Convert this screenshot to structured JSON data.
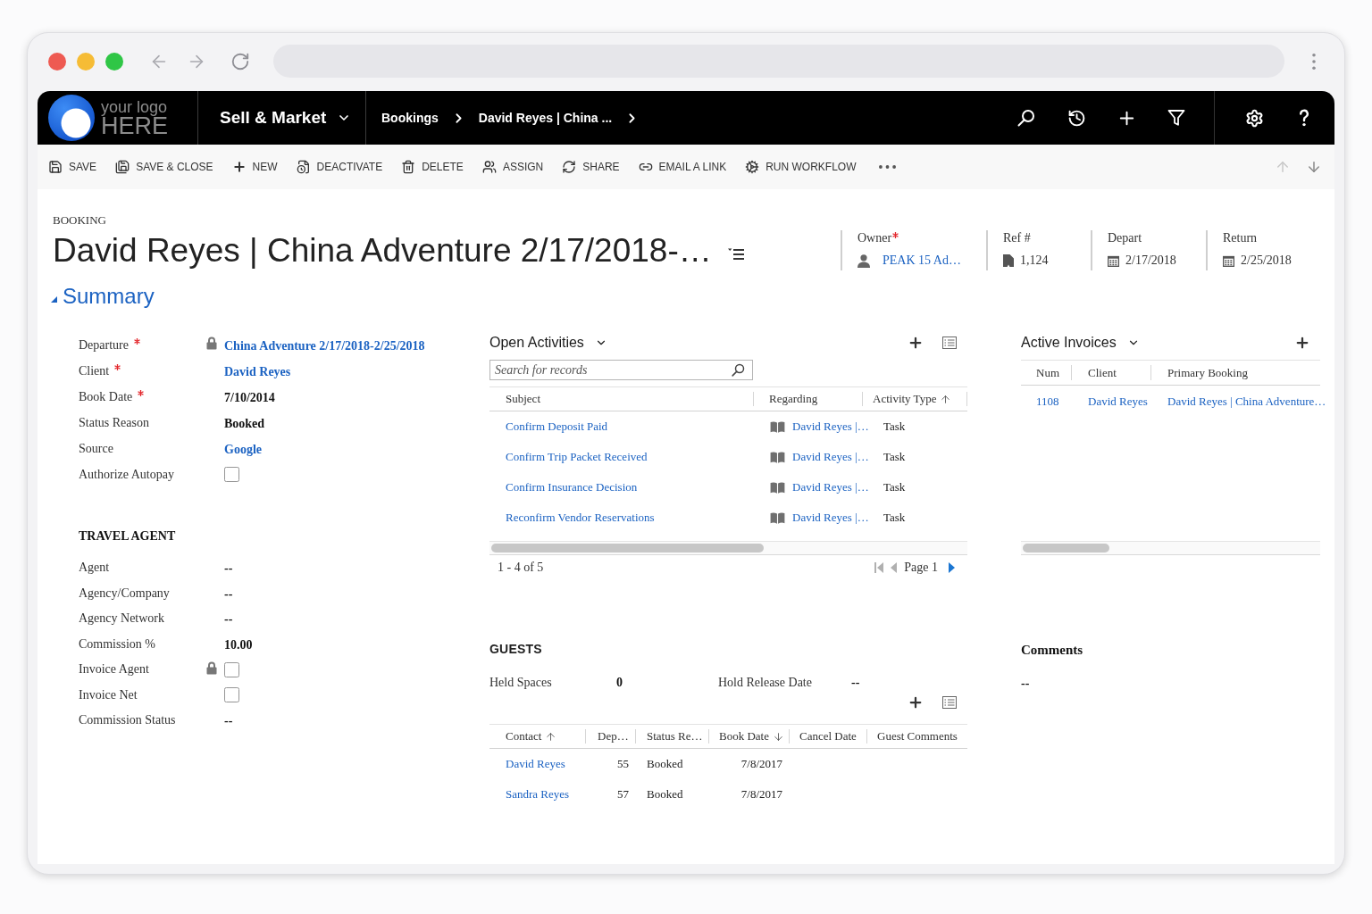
{
  "app_header": {
    "logo": {
      "line_1": "your logo",
      "line_2": "HERE"
    },
    "app_name": "Sell & Market",
    "breadcrumb": [
      "Bookings",
      "David Reyes | China ..."
    ]
  },
  "command_bar": {
    "commands": [
      {
        "kind": "save",
        "label": "SAVE"
      },
      {
        "kind": "save_close",
        "label": "SAVE & CLOSE"
      },
      {
        "kind": "new",
        "label": "NEW"
      },
      {
        "kind": "deactivate",
        "label": "DEACTIVATE"
      },
      {
        "kind": "delete",
        "label": "DELETE"
      },
      {
        "kind": "assign",
        "label": "ASSIGN"
      },
      {
        "kind": "share",
        "label": "SHARE"
      },
      {
        "kind": "email_link",
        "label": "EMAIL A LINK"
      },
      {
        "kind": "run_workflow",
        "label": "RUN WORKFLOW"
      }
    ],
    "record_navigation": [
      {
        "kind": "previous",
        "disabled": true
      },
      {
        "kind": "next",
        "disabled": false
      }
    ]
  },
  "record_header": {
    "entity": "BOOKING",
    "title": "David Reyes | China Adventure 2/17/2018-…",
    "fields": [
      {
        "kind": "user",
        "label": "Owner",
        "required": true,
        "value": "PEAK 15 Ad…"
      },
      {
        "kind": "record",
        "label": "Ref #",
        "required": false,
        "value": "1,124"
      },
      {
        "kind": "date",
        "label": "Depart",
        "required": false,
        "value": "2/17/2018"
      },
      {
        "kind": "date",
        "label": "Return",
        "required": false,
        "value": "2/25/2018"
      }
    ]
  },
  "summary_section": {
    "title": "Summary",
    "expanded": true
  },
  "booking_fields": [
    {
      "label": "Departure",
      "required": true,
      "locked": true,
      "kind": "link",
      "value": "China Adventure 2/17/2018-2/25/2018"
    },
    {
      "label": "Client",
      "required": true,
      "locked": false,
      "kind": "link",
      "value": "David Reyes"
    },
    {
      "label": "Book Date",
      "required": true,
      "locked": false,
      "kind": "text",
      "value": "7/10/2014"
    },
    {
      "label": "Status Reason",
      "required": false,
      "locked": false,
      "kind": "text",
      "value": "Booked"
    },
    {
      "label": "Source",
      "required": false,
      "locked": false,
      "kind": "link",
      "value": "Google"
    },
    {
      "label": "Authorize Autopay",
      "required": false,
      "locked": false,
      "kind": "checkbox",
      "checked": false
    }
  ],
  "travel_agent": {
    "title": "TRAVEL AGENT",
    "fields": [
      {
        "label": "Agent",
        "required": false,
        "locked": false,
        "kind": "text",
        "value": "--"
      },
      {
        "label": "Agency/Company",
        "required": false,
        "locked": false,
        "kind": "text",
        "value": "--"
      },
      {
        "label": "Agency Network",
        "required": false,
        "locked": false,
        "kind": "text",
        "value": "--"
      },
      {
        "label": "Commission %",
        "required": false,
        "locked": false,
        "kind": "text",
        "value": "10.00"
      },
      {
        "label": "Invoice Agent",
        "required": false,
        "locked": true,
        "kind": "checkbox",
        "checked": false
      },
      {
        "label": "Invoice Net",
        "required": false,
        "locked": false,
        "kind": "checkbox",
        "checked": false
      },
      {
        "label": "Commission Status",
        "required": false,
        "locked": false,
        "kind": "text",
        "value": "--"
      }
    ]
  },
  "open_activities": {
    "title": "Open Activities",
    "search": {
      "placeholder": "Search for records"
    },
    "columns": [
      {
        "label": "Subject",
        "sorted_ascending": false,
        "sorted_descending": false
      },
      {
        "label": "Regarding",
        "sorted_ascending": false,
        "sorted_descending": false
      },
      {
        "label": "Activity Type",
        "sorted_ascending": true,
        "sorted_descending": false
      }
    ],
    "rows": [
      {
        "subject": "Confirm Deposit Paid",
        "regarding": "David Reyes |…",
        "activity_type": "Task"
      },
      {
        "subject": "Confirm Trip Packet Received",
        "regarding": "David Reyes |…",
        "activity_type": "Task"
      },
      {
        "subject": "Confirm Insurance Decision",
        "regarding": "David Reyes |…",
        "activity_type": "Task"
      },
      {
        "subject": "Reconfirm Vendor Reservations",
        "regarding": "David Reyes |…",
        "activity_type": "Task"
      }
    ],
    "range": "1 - 4 of 5",
    "page": "Page 1",
    "pager": [
      {
        "kind": "first",
        "disabled": true
      },
      {
        "kind": "previous",
        "disabled": true
      },
      {
        "kind": "next",
        "disabled": false
      }
    ]
  },
  "guests": {
    "title": "GUESTS",
    "fields": [
      {
        "label": "Held Spaces",
        "value": "0"
      },
      {
        "label": "Hold Release Date",
        "value": "--"
      }
    ],
    "columns": [
      {
        "label": "Contact",
        "sorted_ascending": true,
        "sorted_descending": false
      },
      {
        "label": "Dep…",
        "sorted_ascending": false,
        "sorted_descending": false
      },
      {
        "label": "Status Re…",
        "sorted_ascending": false,
        "sorted_descending": false
      },
      {
        "label": "Book Date",
        "sorted_ascending": false,
        "sorted_descending": true
      },
      {
        "label": "Cancel Date",
        "sorted_ascending": false,
        "sorted_descending": false
      },
      {
        "label": "Guest Comments",
        "sorted_ascending": false,
        "sorted_descending": false
      }
    ],
    "rows": [
      {
        "cells": [
          "David Reyes",
          "55",
          "Booked",
          "7/8/2017"
        ]
      },
      {
        "cells": [
          "Sandra Reyes",
          "57",
          "Booked",
          "7/8/2017"
        ]
      }
    ]
  },
  "active_invoices": {
    "title": "Active Invoices",
    "columns": [
      "Num",
      "Client",
      "Primary Booking"
    ],
    "rows": [
      {
        "cells": [
          "1108",
          "David Reyes",
          "David Reyes | China Adventure…"
        ]
      }
    ]
  },
  "comments": {
    "title": "Comments",
    "value": "--"
  }
}
